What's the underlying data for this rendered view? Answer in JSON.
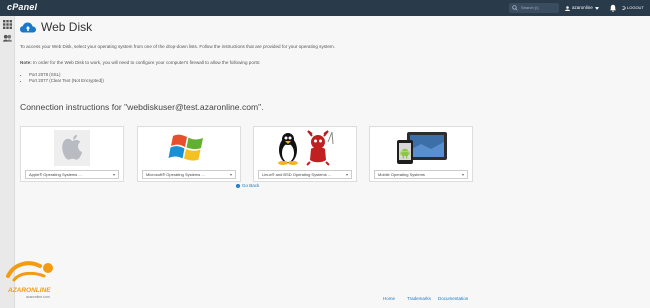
{
  "header": {
    "logo": "cPanel",
    "search_placeholder": "Search (/)",
    "username": "azaronline",
    "logout": "LOGOUT"
  },
  "page": {
    "title": "Web Disk",
    "intro": "To access your Web Disk, select your operating system from one of the drop-down lists. Follow the instructions that are provided for your operating system.",
    "note_label": "Note:",
    "note_text": "In order for the Web Disk to work, you will need to configure your computer's firewall to allow the following ports:",
    "ports": [
      "Port 2078 (SSL)",
      "Port 2077 (Clear Text (Not Encrypted))"
    ],
    "connection_heading": "Connection instructions for \"webdiskuser@test.azaronline.com\".",
    "go_back": "Go Back"
  },
  "os_cards": [
    {
      "name": "apple",
      "select": "Apple® Operating Systems ..."
    },
    {
      "name": "windows",
      "select": "Microsoft® Operating Systems ..."
    },
    {
      "name": "linux",
      "select": "Linux® and BSD Operating Systems ..."
    },
    {
      "name": "mobile",
      "select": "Mobile Operating Systems"
    }
  ],
  "watermark": {
    "brand": "AZARONLINE",
    "domain": "azaronline.com"
  },
  "footer": {
    "home": "Home",
    "trademarks": "Trademarks",
    "documentation": "Documentation"
  },
  "colors": {
    "topbar": "#293a4a",
    "link": "#1b78c9",
    "watermark_orange": "#f39c12"
  }
}
